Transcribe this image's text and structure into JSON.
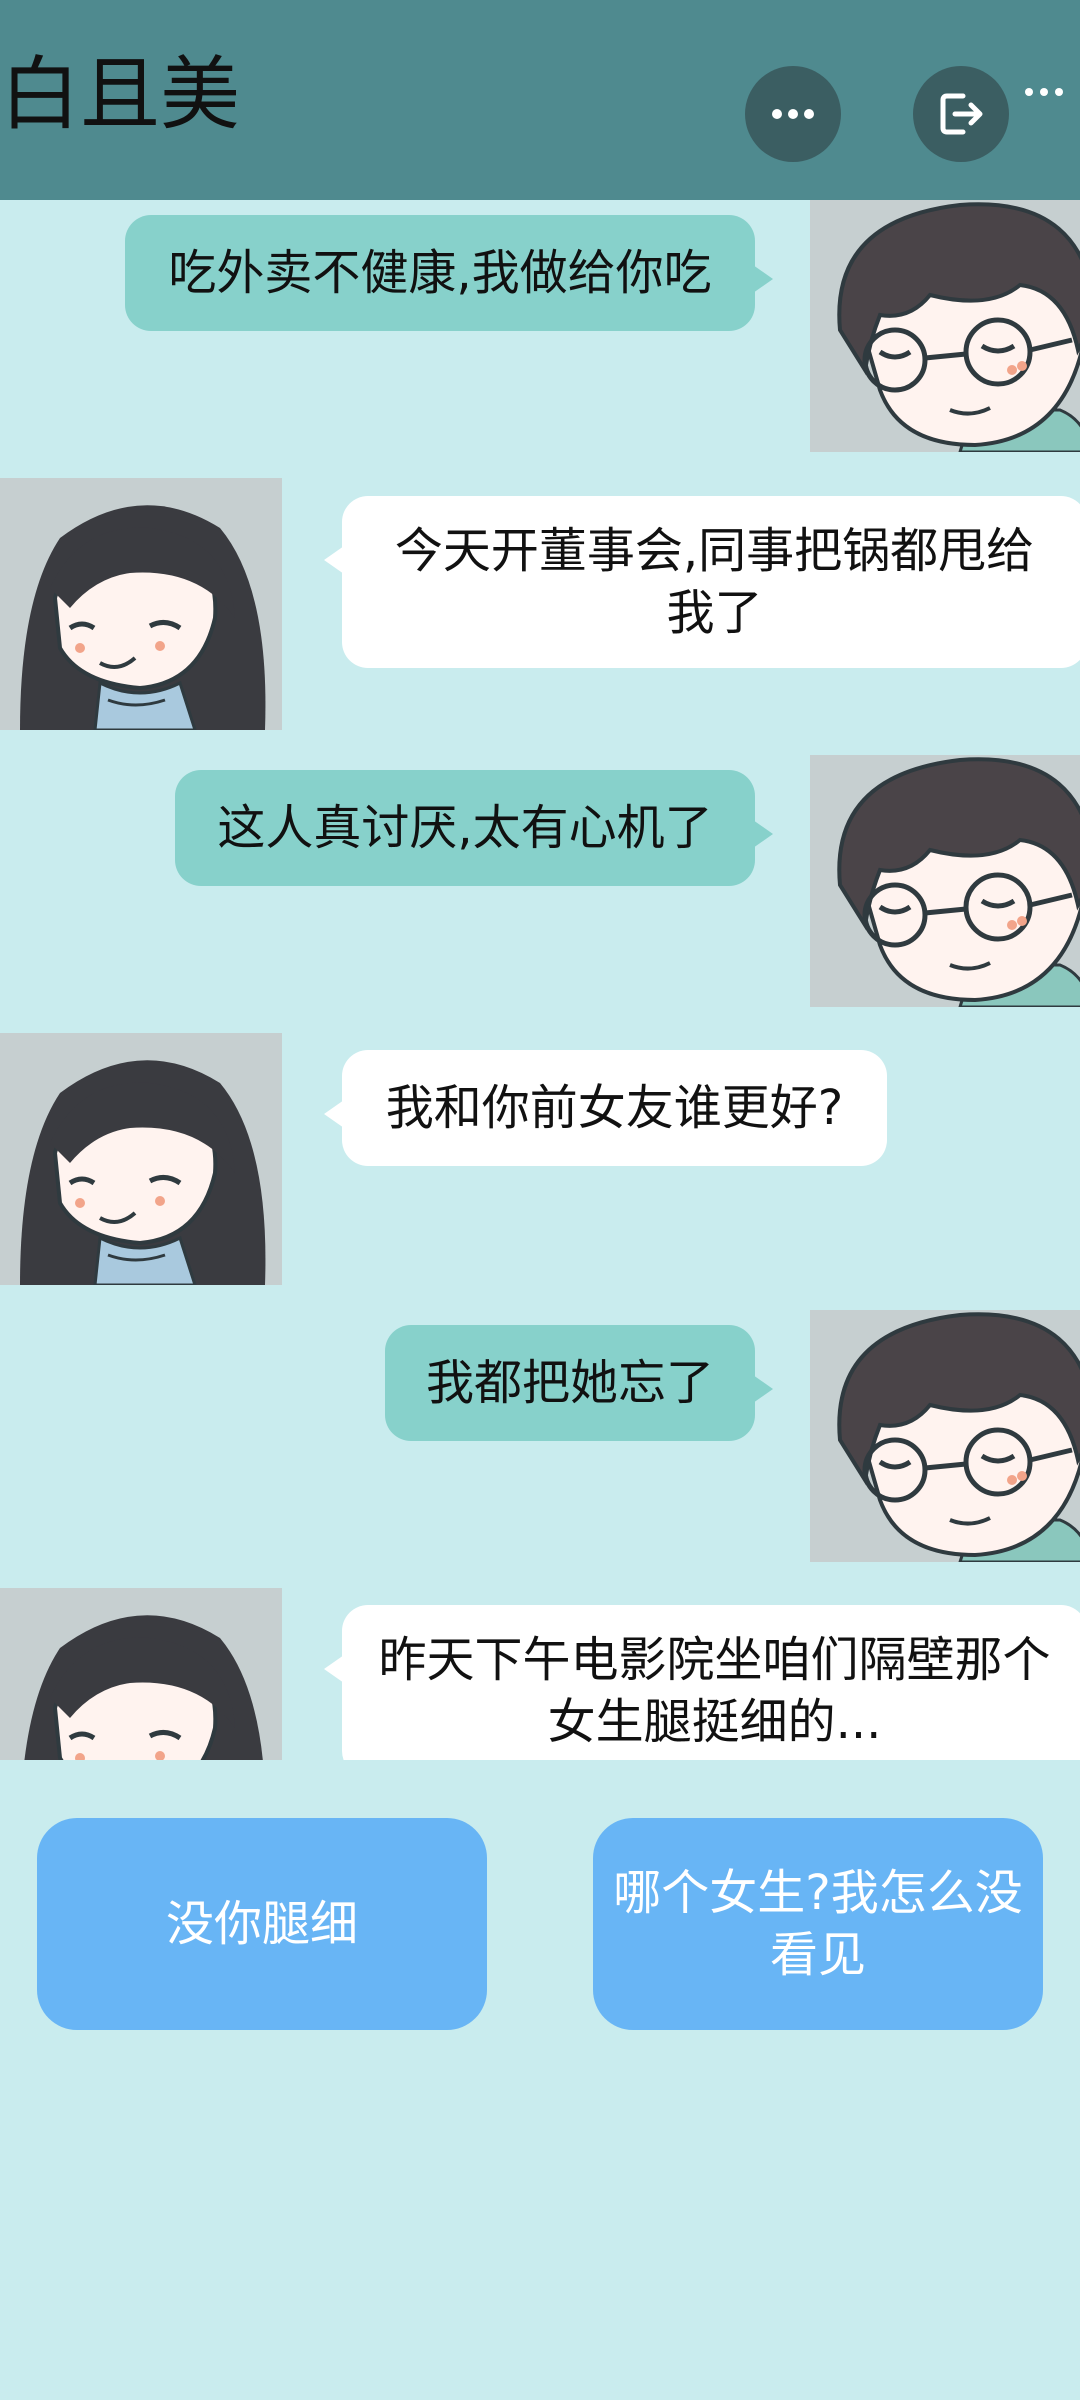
{
  "header": {
    "title": "白且美",
    "more_icon": "more-dots-icon",
    "exit_icon": "exit-icon"
  },
  "messages": [
    {
      "sender": "boy",
      "text": "吃外卖不健康,我做给你吃"
    },
    {
      "sender": "girl",
      "text": "今天开董事会,同事把锅都甩给我了"
    },
    {
      "sender": "boy",
      "text": "这人真讨厌,太有心机了"
    },
    {
      "sender": "girl",
      "text": "我和你前女友谁更好?"
    },
    {
      "sender": "boy",
      "text": "我都把她忘了"
    },
    {
      "sender": "girl",
      "text": "昨天下午电影院坐咱们隔壁那个女生腿挺细的..."
    }
  ],
  "choices": [
    {
      "label": "没你腿细"
    },
    {
      "label": "哪个女生?我怎么没看见"
    }
  ],
  "colors": {
    "header_bg": "#4f8a8f",
    "chat_bg": "#c9ecee",
    "boy_bubble": "#87d1cb",
    "girl_bubble": "#ffffff",
    "choice_button": "#68b5f5"
  }
}
